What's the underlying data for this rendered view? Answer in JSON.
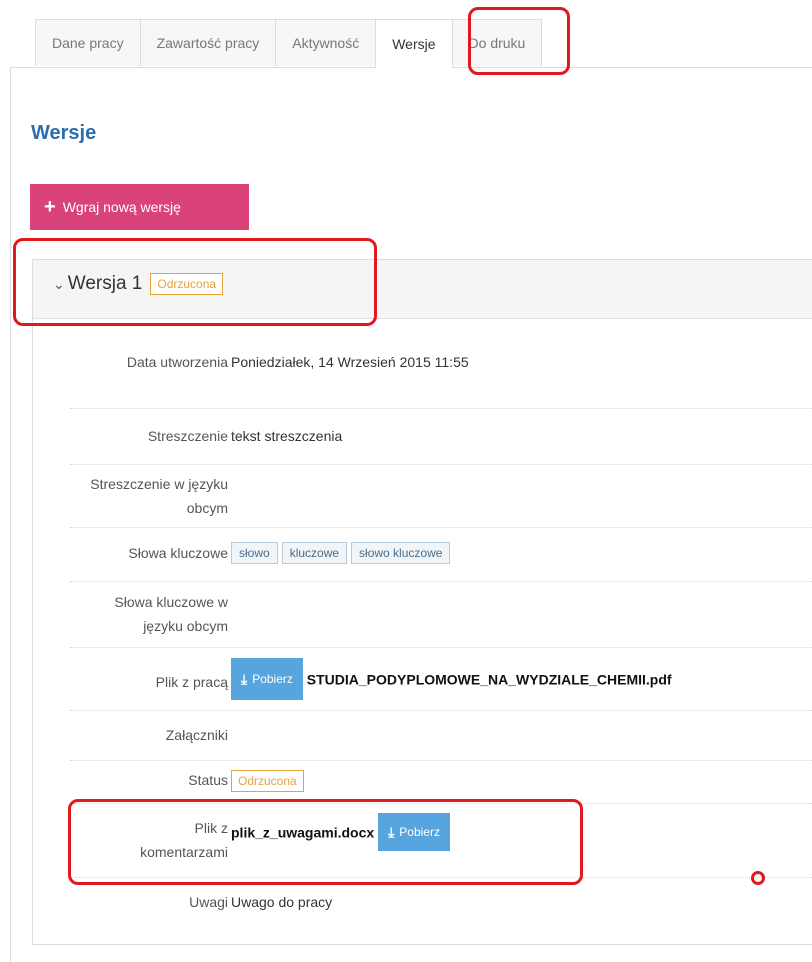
{
  "tabs": [
    "Dane pracy",
    "Zawartość pracy",
    "Aktywność",
    "Wersje",
    "Do druku"
  ],
  "section_title": "Wersje",
  "upload_button": "Wgraj nową wersję",
  "version": {
    "title": "Wersja 1",
    "status": "Odrzucona",
    "fields": {
      "created_label": "Data utworzenia",
      "created_value": "Poniedziałek, 14 Wrzesień 2015 11:55",
      "abstract_label": "Streszczenie",
      "abstract_value": "tekst streszczenia",
      "abstract_foreign_label": "Streszczenie w języku obcym",
      "keywords_label": "Słowa kluczowe",
      "keywords": [
        "słowo",
        "kluczowe",
        "słowo kluczowe"
      ],
      "keywords_foreign_label": "Słowa kluczowe w języku obcym",
      "file_label": "Plik z pracą",
      "file_button": "Pobierz",
      "file_name": "STUDIA_PODYPLOMOWE_NA_WYDZIALE_CHEMII.pdf",
      "attachments_label": "Załączniki",
      "status_label": "Status",
      "status_value": "Odrzucona",
      "comments_file_label": "Plik z komentarzami",
      "comments_file_name": "plik_z_uwagami.docx",
      "comments_file_button": "Pobierz",
      "notes_label": "Uwagi",
      "notes_value": "Uwago do pracy"
    }
  },
  "colors": {
    "accent": "#2a6db0",
    "upload": "#d9437a",
    "download": "#57a5de",
    "rejected": "#e8a23a",
    "annotation": "#e0191f"
  }
}
